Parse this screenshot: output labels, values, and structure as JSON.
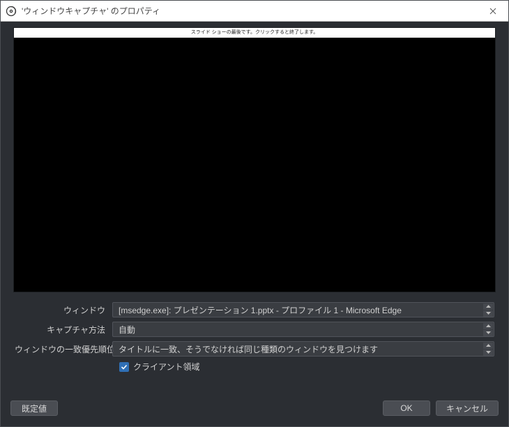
{
  "titlebar": {
    "title": "'ウィンドウキャプチャ' のプロパティ"
  },
  "preview": {
    "topbar_text": "スライド ショーの最後です。クリックすると終了します。"
  },
  "form": {
    "window_label": "ウィンドウ",
    "window_value": "[msedge.exe]: プレゼンテーション 1.pptx - プロファイル 1 - Microsoft Edge",
    "capture_method_label": "キャプチャ方法",
    "capture_method_value": "自動",
    "match_priority_label": "ウィンドウの一致優先順位",
    "match_priority_value": "タイトルに一致、そうでなければ同じ種類のウィンドウを見つけます",
    "client_area_label": "クライアント領域",
    "client_area_checked": true
  },
  "footer": {
    "defaults_label": "既定値",
    "ok_label": "OK",
    "cancel_label": "キャンセル"
  }
}
